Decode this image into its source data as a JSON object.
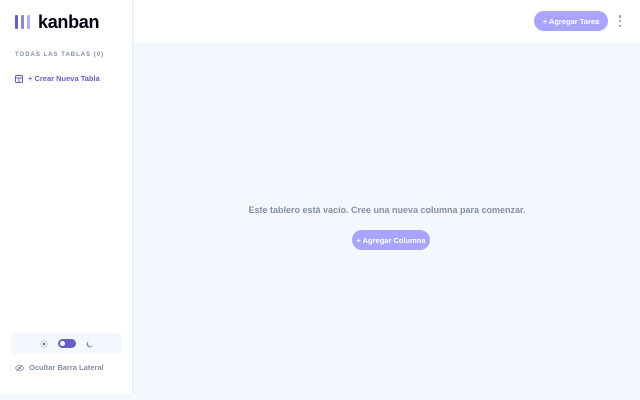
{
  "app": {
    "logo_text": "kanban"
  },
  "sidebar": {
    "all_boards_label": "TODAS LAS TABLAS (0)",
    "create_board_label": "+ Crear Nueva Tabla",
    "hide_sidebar_label": "Ocultar Barra Lateral",
    "theme_toggle": {
      "mode": "dark"
    }
  },
  "header": {
    "add_task_label": "+ Agregar Tarea"
  },
  "main": {
    "empty_message": "Este tablero está vacío. Cree una nueva columna para comenzar.",
    "add_column_label": "+ Agregar Columna"
  },
  "colors": {
    "accent": "#635fc7",
    "accent_light": "#a8a4ff",
    "muted_text": "#828fa3",
    "background": "#f4f7fd",
    "surface": "#ffffff"
  }
}
